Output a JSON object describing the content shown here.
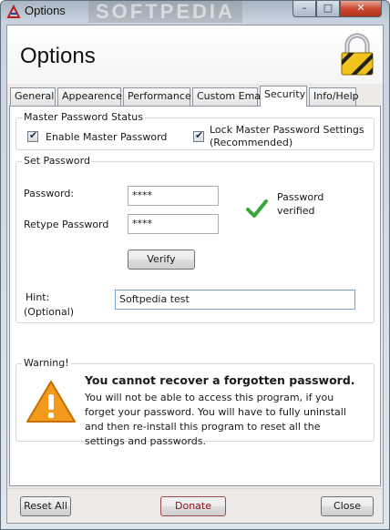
{
  "window": {
    "title": "Options",
    "watermark": "SOFTPEDIA",
    "min_glyph": "–",
    "max_glyph": "□",
    "close_glyph": "✕"
  },
  "header": {
    "title": "Options",
    "icon": "padlock-icon"
  },
  "tabs": [
    {
      "label": "General"
    },
    {
      "label": "Appearence"
    },
    {
      "label": "Performance"
    },
    {
      "label": "Custom Email"
    },
    {
      "label": "Security",
      "active": true
    },
    {
      "label": "Info/Help"
    }
  ],
  "master": {
    "group_title": "Master Password Status",
    "enable_label": "Enable Master Password",
    "enable_checked": true,
    "lock_label_line1": "Lock Master Password Settings",
    "lock_label_line2": "(Recommended)",
    "lock_checked": true
  },
  "setpw": {
    "group_title": "Set Password",
    "password_label": "Password:",
    "password_value": "****",
    "retype_label": "Retype Password",
    "retype_value": "****",
    "status_line1": "Password",
    "status_line2": "verified",
    "verify_label": "Verify",
    "hint_label_line1": "Hint:",
    "hint_label_line2": "(Optional)",
    "hint_value": "Softpedia test"
  },
  "warning": {
    "group_title": "Warning!",
    "title": "You cannot recover a forgotten password.",
    "body": "You will not be able to access this program, if you forget your password. You will have to fully uninstall and then re-install this program to reset all the settings and passwords."
  },
  "footer": {
    "reset_label": "Reset All",
    "donate_label": "Donate",
    "close_label": "Close"
  },
  "colors": {
    "check_green": "#3aa53a",
    "warning_orange": "#f39a1e",
    "donate_text": "#8a1010"
  }
}
